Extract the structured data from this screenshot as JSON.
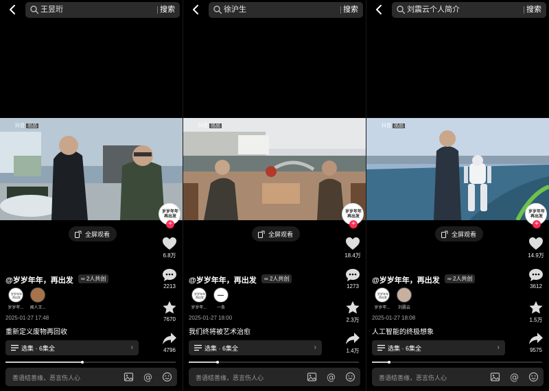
{
  "panels": [
    {
      "search_query": "王昱珩",
      "search_button": "搜索",
      "watermark": "抖音",
      "watermark_tag": "出品",
      "fullscreen_label": "全屏观看",
      "avatar_text": "岁岁年年再出发",
      "likes": "6.8万",
      "comments": "2213",
      "favorites": "7670",
      "shares": "4796",
      "author": "@岁岁年年，再出发",
      "collab": "2人共创",
      "collaborators": [
        "岁岁年...",
        "闻人王..."
      ],
      "date": "2025-01-27 17:48",
      "title": "重新定义废物再回收",
      "collection": "选集 · 6集全",
      "progress": 0.45,
      "comment_placeholder": "善语结善缘，恶言伤人心"
    },
    {
      "search_query": "徐沪生",
      "search_button": "搜索",
      "watermark": "抖音",
      "watermark_tag": "出品",
      "fullscreen_label": "全屏观看",
      "avatar_text": "岁岁年年再出发",
      "likes": "18.4万",
      "comments": "1273",
      "favorites": "2.3万",
      "shares": "1.4万",
      "author": "@岁岁年年，再出发",
      "collab": "2人共创",
      "collaborators": [
        "岁岁年...",
        "一条"
      ],
      "date": "2025-01-27 18:00",
      "title": "我们终将被艺术治愈",
      "collection": "选集 · 6集全",
      "progress": 0.17,
      "comment_placeholder": "善语结善缘，恶言伤人心"
    },
    {
      "search_query": "刘震云个人简介",
      "search_button": "搜索",
      "watermark": "抖音",
      "watermark_tag": "出品",
      "fullscreen_label": "全屏观看",
      "avatar_text": "岁岁年年再出发",
      "likes": "14.9万",
      "comments": "3612",
      "favorites": "1.5万",
      "shares": "9575",
      "author": "@岁岁年年，再出发",
      "collab": "2人共创",
      "collaborators": [
        "岁岁年...",
        "刘震云"
      ],
      "date": "2025-01-27 18:08",
      "title": "人工智能的终极想象",
      "collection": "选集 · 6集全",
      "progress": 0.1,
      "comment_placeholder": "善语结善缘，恶言伤人心"
    }
  ],
  "colors": {
    "background": "#000000",
    "accent_red": "#fe2c55",
    "input_bg": "#262626"
  }
}
